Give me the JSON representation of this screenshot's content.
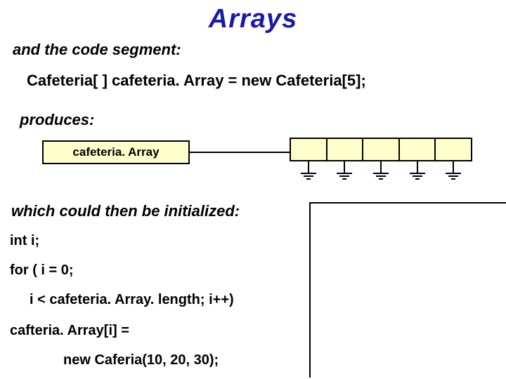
{
  "title": "Arrays",
  "lines": {
    "and": "and the code segment:",
    "code1": "Cafeteria[ ] cafeteria. Array = new Cafeteria[5];",
    "produces": "produces:",
    "which": "which could then be initialized:",
    "inti": "int i;",
    "for": "for ( i = 0;",
    "cond": "i < cafeteria. Array. length; i++)",
    "assign": "cafteria. Array[i] =",
    "new": "new Caferia(10, 20, 30);"
  },
  "diagram": {
    "var_label": "cafeteria. Array",
    "cells": 5
  }
}
